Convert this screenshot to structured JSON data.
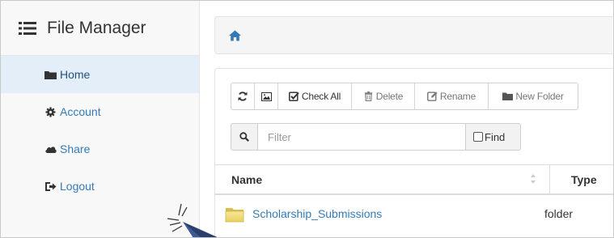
{
  "sidebar": {
    "brand": "File Manager",
    "items": [
      {
        "label": "Home",
        "icon": "folder-icon",
        "active": true
      },
      {
        "label": "Account",
        "icon": "gear-icon",
        "active": false
      },
      {
        "label": "Share",
        "icon": "cloud-icon",
        "active": false
      },
      {
        "label": "Logout",
        "icon": "logout-icon",
        "active": false
      }
    ]
  },
  "breadcrumb": {
    "home_icon": "home-icon"
  },
  "toolbar": {
    "refresh_icon": "refresh-icon",
    "image_icon": "image-icon",
    "check_all": "Check All",
    "delete": "Delete",
    "rename": "Rename",
    "new_folder": "New Folder"
  },
  "filter": {
    "placeholder": "Filter",
    "find_label": "Find"
  },
  "table": {
    "headers": {
      "name": "Name",
      "type": "Type"
    },
    "rows": [
      {
        "name": "Scholarship_Submissions",
        "type": "folder"
      }
    ]
  },
  "colors": {
    "link": "#337ab7",
    "active_bg": "#e4eef8",
    "sidebar_bg": "#f8f8f8"
  }
}
